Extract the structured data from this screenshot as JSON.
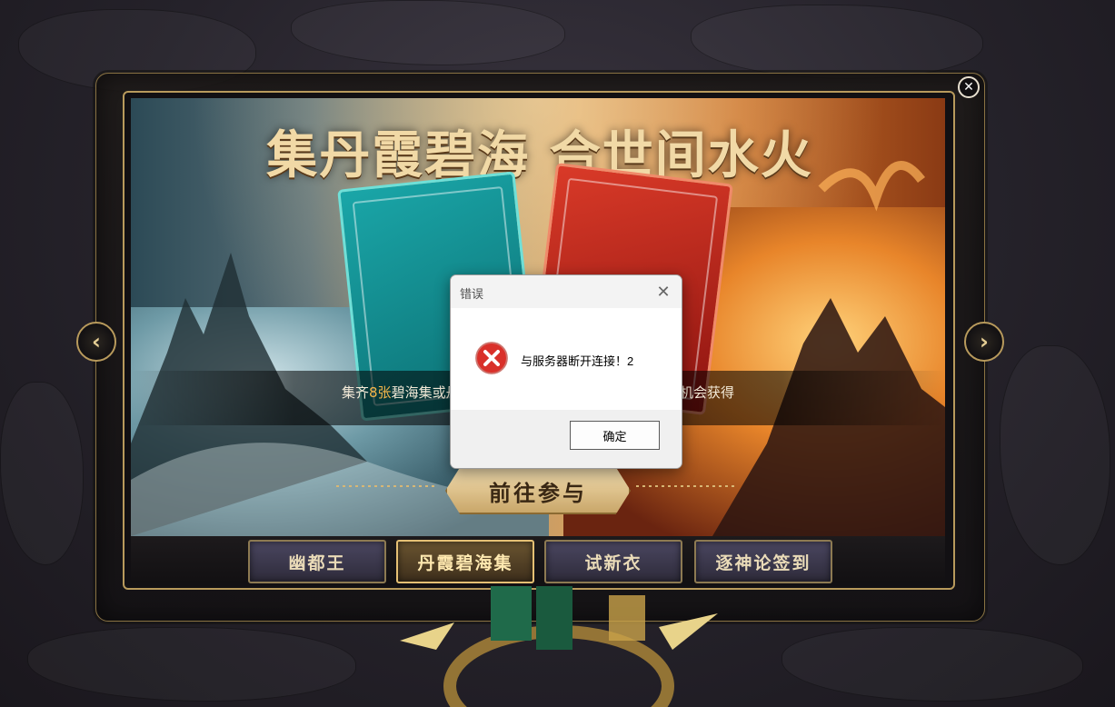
{
  "banner": {
    "title": "集丹霞碧海 合世间水火",
    "description_left_prefix": "集齐",
    "description_left_highlight": "8张",
    "description_left_suffix": "碧海集或丹",
    "description_right": "机会获得",
    "join_button": "前往参与"
  },
  "tabs": [
    {
      "label": "幽都王",
      "active": false
    },
    {
      "label": "丹霞碧海集",
      "active": true
    },
    {
      "label": "试新衣",
      "active": false
    },
    {
      "label": "逐神论签到",
      "active": false
    }
  ],
  "nav": {
    "prev_icon": "chevron-left-icon",
    "next_icon": "chevron-right-icon",
    "close_icon": "close-icon"
  },
  "dialog": {
    "title": "错误",
    "message": "与服务器断开连接！2",
    "ok_button": "确定",
    "icon": "error-icon"
  },
  "colors": {
    "highlight": "#f4b64a",
    "frame_gold": "#b89a5c",
    "dialog_bg": "#f0f0f0"
  }
}
